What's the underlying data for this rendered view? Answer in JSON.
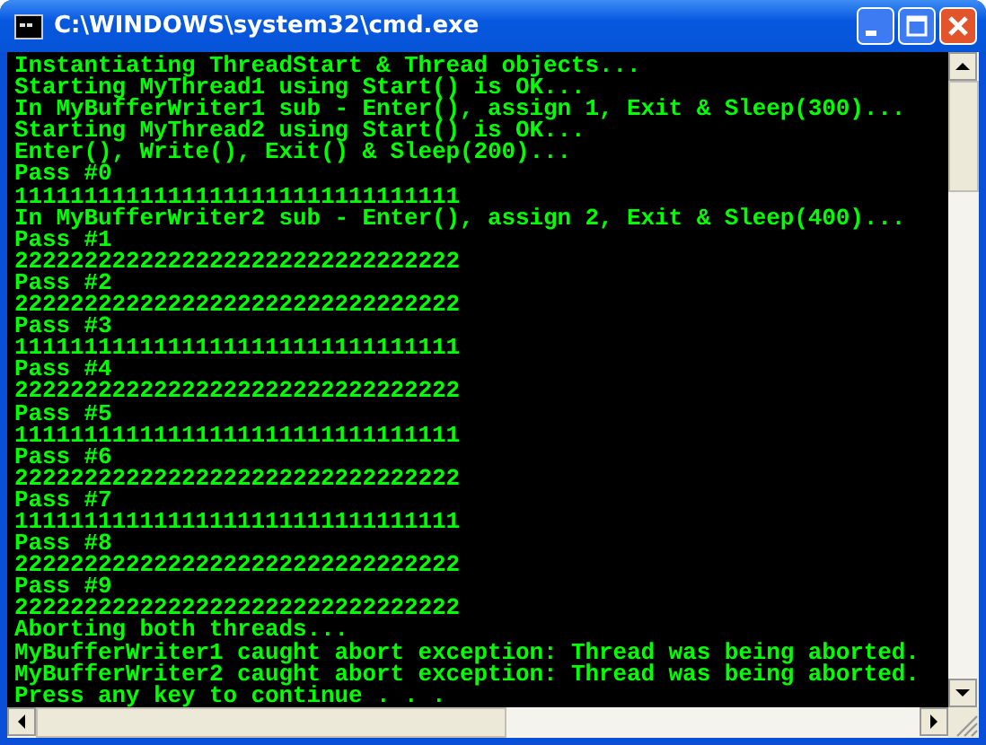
{
  "window": {
    "title": "C:\\WINDOWS\\system32\\cmd.exe"
  },
  "console": {
    "lines": [
      "Instantiating ThreadStart & Thread objects...",
      "Starting MyThread1 using Start() is OK...",
      "In MyBufferWriter1 sub - Enter(), assign 1, Exit & Sleep(300)...",
      "Starting MyThread2 using Start() is OK...",
      "Enter(), Write(), Exit() & Sleep(200)...",
      "Pass #0",
      "11111111111111111111111111111111",
      "In MyBufferWriter2 sub - Enter(), assign 2, Exit & Sleep(400)...",
      "Pass #1",
      "22222222222222222222222222222222",
      "Pass #2",
      "22222222222222222222222222222222",
      "Pass #3",
      "11111111111111111111111111111111",
      "Pass #4",
      "22222222222222222222222222222222",
      "Pass #5",
      "11111111111111111111111111111111",
      "Pass #6",
      "22222222222222222222222222222222",
      "Pass #7",
      "11111111111111111111111111111111",
      "Pass #8",
      "22222222222222222222222222222222",
      "Pass #9",
      "22222222222222222222222222222222",
      "Aborting both threads...",
      "MyBufferWriter1 caught abort exception: Thread was being aborted.",
      "MyBufferWriter2 caught abort exception: Thread was being aborted.",
      "Press any key to continue . . ."
    ]
  }
}
